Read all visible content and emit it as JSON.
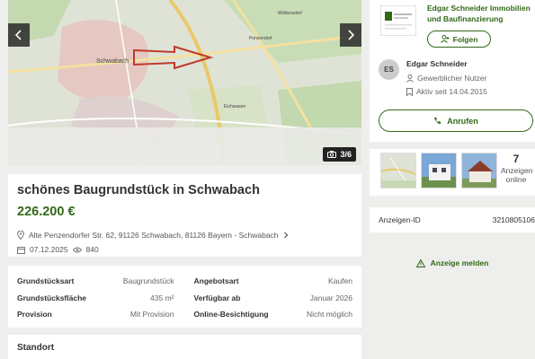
{
  "gallery": {
    "counter": "3/6",
    "map_labels": [
      "Penzendorf",
      "Schwabach",
      "Wolkersdorf",
      "Eichwasen"
    ]
  },
  "listing": {
    "title": "schönes Baugrundstück in Schwabach",
    "price": "226.200 €",
    "address": "Alte Penzendorfer Str. 62, 91126 Schwabach, 81126 Bayern - Schwabach",
    "date": "07.12.2025",
    "views": "840"
  },
  "details": [
    {
      "l_label": "Grundstücksart",
      "l_value": "Baugrundstück",
      "r_label": "Angebotsart",
      "r_value": "Kaufen"
    },
    {
      "l_label": "Grundstücksfläche",
      "l_value": "435 m²",
      "r_label": "Verfügbar ab",
      "r_value": "Januar 2026"
    },
    {
      "l_label": "Provision",
      "l_value": "Mit Provision",
      "r_label": "Online-Besichtigung",
      "r_value": "Nicht möglich"
    }
  ],
  "standort": {
    "heading": "Standort"
  },
  "seller": {
    "company": "Edgar Schneider Immobilien und Baufinanzierung",
    "follow_label": "Folgen",
    "initials": "ES",
    "name": "Edgar Schneider",
    "type": "Gewerblicher Nutzer",
    "active_since": "Aktiv seit 14.04.2015",
    "call_label": "Anrufen"
  },
  "thumbnails": {
    "more_count": "7",
    "more_label": "Anzeigen online"
  },
  "ad_id": {
    "label": "Anzeigen-ID",
    "value": "3210805106"
  },
  "report": {
    "label": "Anzeige melden"
  },
  "colors": {
    "accent": "#326916",
    "background": "#eeeeec"
  }
}
